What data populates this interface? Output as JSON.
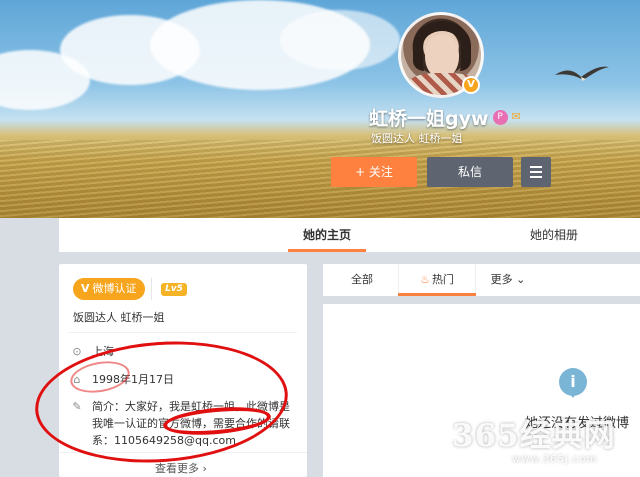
{
  "profile": {
    "username": "虹桥一姐gyw",
    "subtitle": "饭圆达人 虹桥一姐",
    "verified_icon": "V",
    "level_badge_icon": "P",
    "group_badge_icon": "✉"
  },
  "actions": {
    "follow_label": "+ 关注",
    "message_label": "私信"
  },
  "tabs": {
    "home_label": "她的主页",
    "album_label": "她的相册"
  },
  "card": {
    "vbadge_symbol": "V",
    "vbadge_label": "微博认证",
    "level": "Lv5",
    "cert_text": "饭圆达人 虹桥一姐",
    "location_icon": "⊙",
    "location": "上海",
    "birthday_icon": "⌂",
    "birthday": "1998年1月17日",
    "bio_icon": "✎",
    "bio": "简介：大家好，我是虹桥一姐，此微博是我唯一认证的官方微博，需要合作的请联系：1105649258@qq.com",
    "more_label": "查看更多 ›"
  },
  "feed": {
    "tab_all": "全部",
    "tab_hot": "热门",
    "hot_icon": "♨",
    "tab_more": "更多 ⌄",
    "empty_icon": "i",
    "empty_text": "她还没有发过微博"
  },
  "watermark": {
    "main": "365经典网",
    "url": "www.365J.com"
  }
}
